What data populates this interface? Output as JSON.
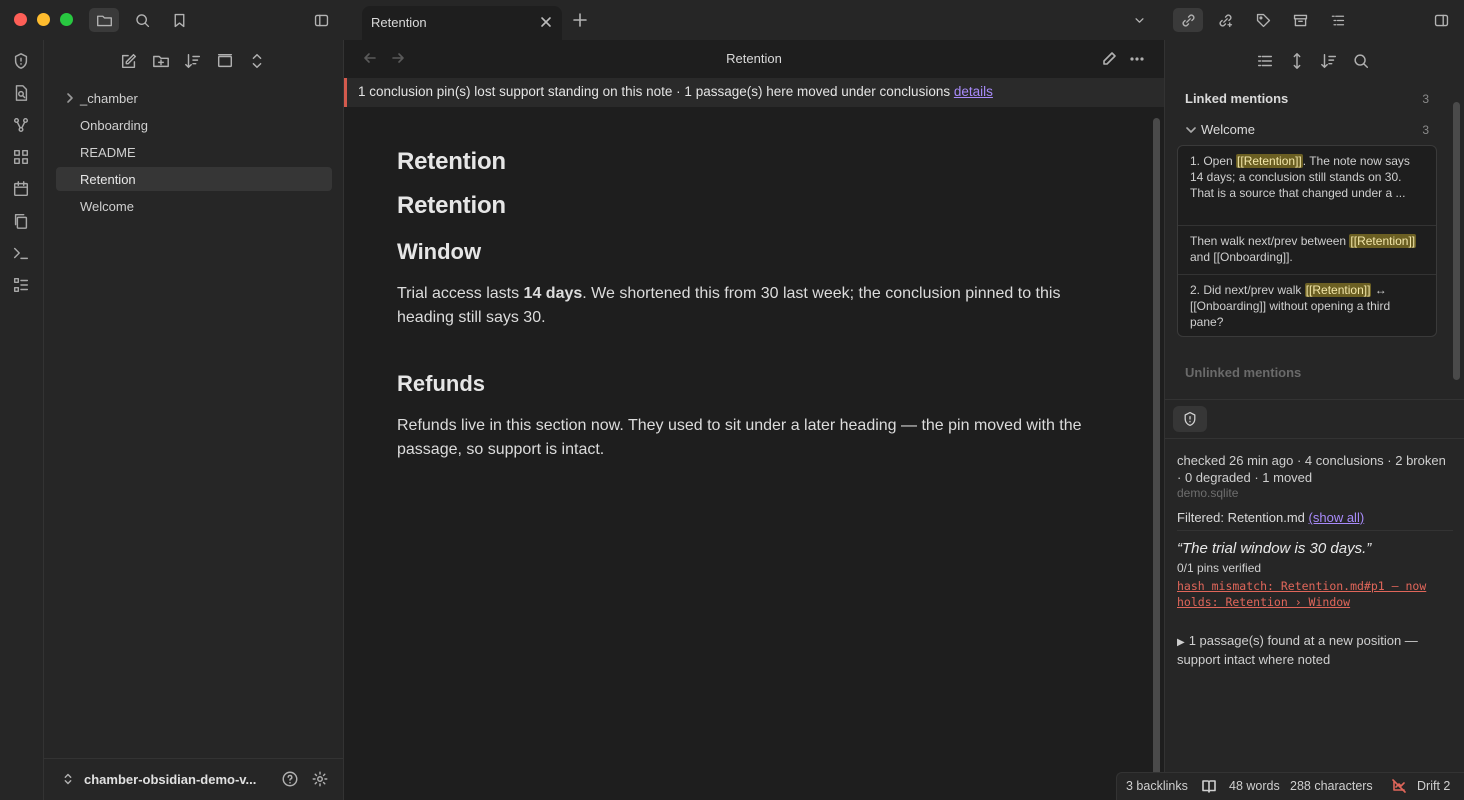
{
  "tab": {
    "title": "Retention"
  },
  "explorer": {
    "items": [
      {
        "label": "_chamber",
        "folder": true
      },
      {
        "label": "Onboarding"
      },
      {
        "label": "README"
      },
      {
        "label": "Retention",
        "active": true
      },
      {
        "label": "Welcome"
      }
    ],
    "vault_name": "chamber-obsidian-demo-v..."
  },
  "editor": {
    "title": "Retention",
    "banner": {
      "text": "1 conclusion pin(s) lost support standing on this note · 1 passage(s) here moved under conclusions",
      "link": "details"
    },
    "doc": {
      "h1a": "Retention",
      "h1b": "Retention",
      "h_window": "Window",
      "p1_before": "Trial access lasts ",
      "p1_bold": "14 days",
      "p1_after": ". We shortened this from 30 last week; the conclusion pinned to this heading still says 30.",
      "h_refunds": "Refunds",
      "p2": "Refunds live in this section now. They used to sit under a later heading — the pin moved with the passage, so support is intact."
    }
  },
  "backlinks": {
    "linked_title": "Linked mentions",
    "linked_count": "3",
    "group_name": "Welcome",
    "group_count": "3",
    "m1_pre": "1. Open ",
    "m1_hl": "[[Retention]]",
    "m1_post": ". The note now says 14 days; a conclusion still stands on 30. That is a source that changed under a ...",
    "m2_pre": "Then walk next/prev between ",
    "m2_hl": "[[Retention]]",
    "m2_post": " and [[Onboarding]].",
    "m3_pre": "2. Did next/prev walk ",
    "m3_hl": "[[Retention]]",
    "m3_post": " ↔ [[Onboarding]] without opening a third pane?",
    "unlinked_title": "Unlinked mentions"
  },
  "chamber": {
    "checked": "checked 26 min ago · 4 conclusions · 2 broken · 0 degraded · 1 moved",
    "db": "demo.sqlite",
    "filtered_label": "Filtered: Retention.md",
    "show_all": "(show all)",
    "quote": "“The trial window is 30 days.”",
    "pins": "0/1 pins verified",
    "hash": "hash mismatch: Retention.md#p1 — now holds: Retention › Window",
    "moved": "1 passage(s) found at a new position — support intact where noted"
  },
  "status": {
    "backlinks": "3 backlinks",
    "words": "48 words",
    "chars": "288 characters",
    "drift": "Drift 2"
  },
  "colors": {
    "accent": "#a88bfa",
    "warning": "#d35a4d",
    "highlight": "#6b5f23"
  }
}
